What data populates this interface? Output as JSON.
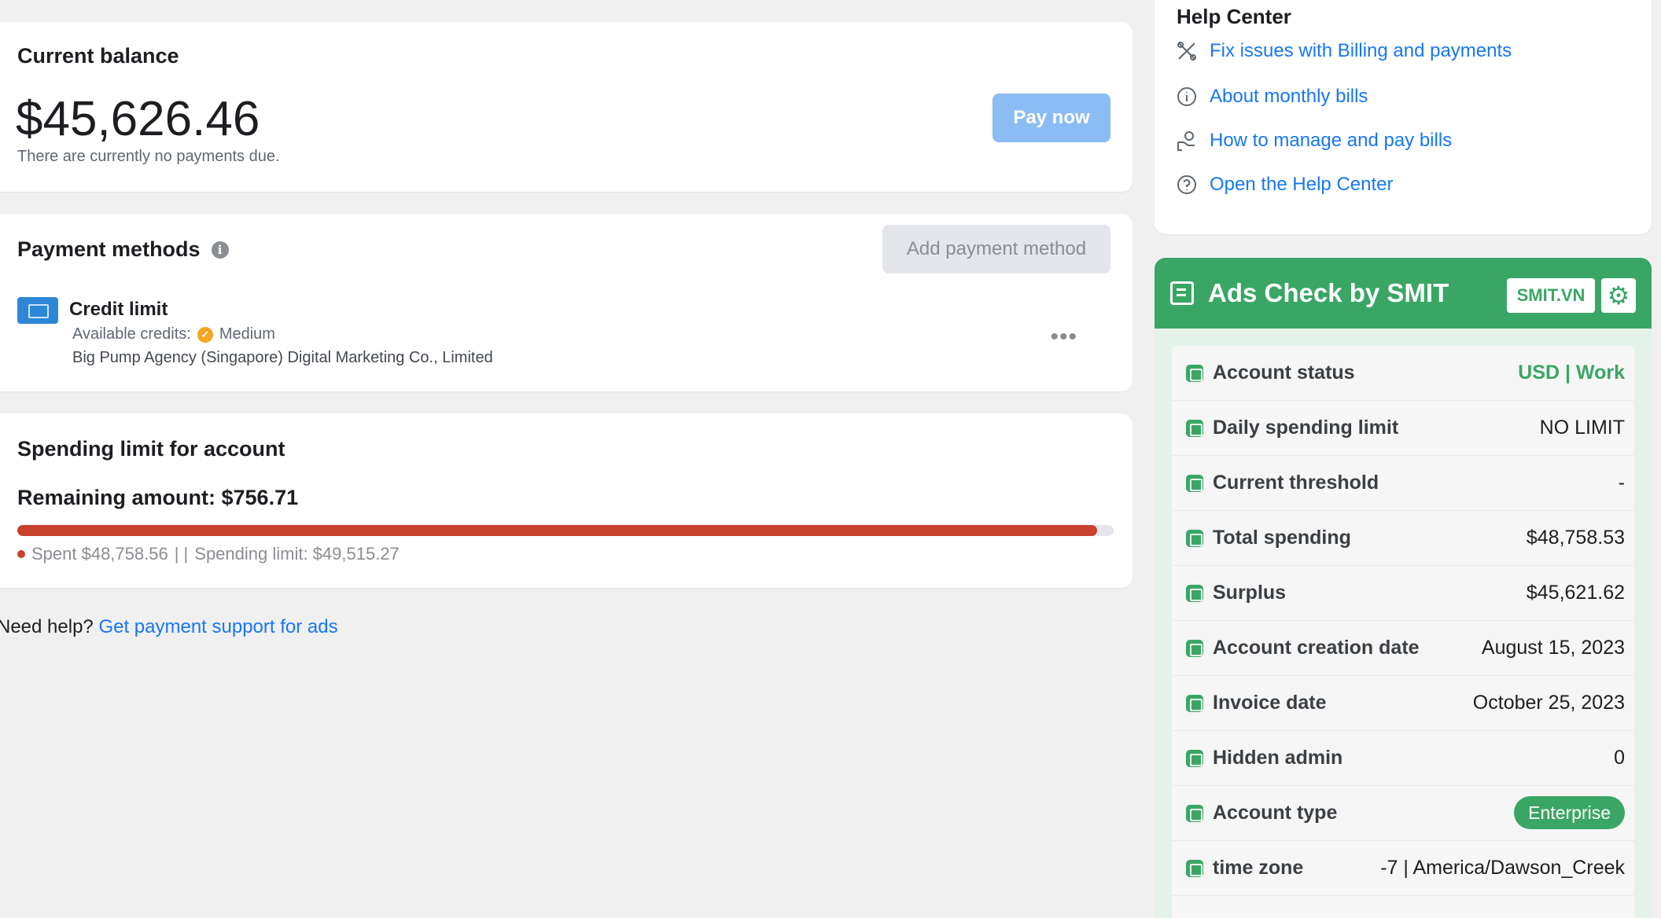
{
  "balance": {
    "title": "Current balance",
    "amount": "$45,626.46",
    "note": "There are currently no payments due.",
    "pay_label": "Pay now"
  },
  "payment": {
    "title": "Payment methods",
    "add_label": "Add payment method",
    "method": {
      "title": "Credit limit",
      "available_label": "Available credits:",
      "level": "Medium",
      "company": "Big Pump Agency (Singapore) Digital Marketing Co., Limited"
    },
    "more": "•••"
  },
  "spending": {
    "title": "Spending limit for account",
    "remaining": "Remaining amount: $756.71",
    "spent": "Spent $48,758.56",
    "limit": "Spending limit: $49,515.27",
    "separator": "|  |",
    "progress_fraction": 0.985
  },
  "needhelp": {
    "prefix": "Need help?",
    "link": "Get payment support for ads"
  },
  "help_center": {
    "title": "Help Center",
    "items": [
      {
        "label": "Fix issues with Billing and payments",
        "icon": "tools-icon"
      },
      {
        "label": "About monthly bills",
        "icon": "info-icon"
      },
      {
        "label": "How to manage and pay bills",
        "icon": "hand-coin-icon"
      },
      {
        "label": "Open the Help Center",
        "icon": "question-icon"
      }
    ]
  },
  "ads_check": {
    "title": "Ads Check by SMIT",
    "badge": "SMIT.VN",
    "rows": [
      {
        "label": "Account status",
        "value": "USD | Work"
      },
      {
        "label": "Daily spending limit",
        "value": "NO LIMIT"
      },
      {
        "label": "Current threshold",
        "value": "-"
      },
      {
        "label": "Total spending",
        "value": "$48,758.53"
      },
      {
        "label": "Surplus",
        "value": "$45,621.62"
      },
      {
        "label": "Account creation date",
        "value": "August 15, 2023"
      },
      {
        "label": "Invoice date",
        "value": "October 25, 2023"
      },
      {
        "label": "Hidden admin",
        "value": "0"
      },
      {
        "label": "Account type",
        "value": "Enterprise"
      },
      {
        "label": "time zone",
        "value": "-7 | America/Dawson_Creek"
      }
    ]
  },
  "colors": {
    "link": "#1877f2",
    "progress": "#c8412d",
    "smit_green": "#3aa665"
  }
}
